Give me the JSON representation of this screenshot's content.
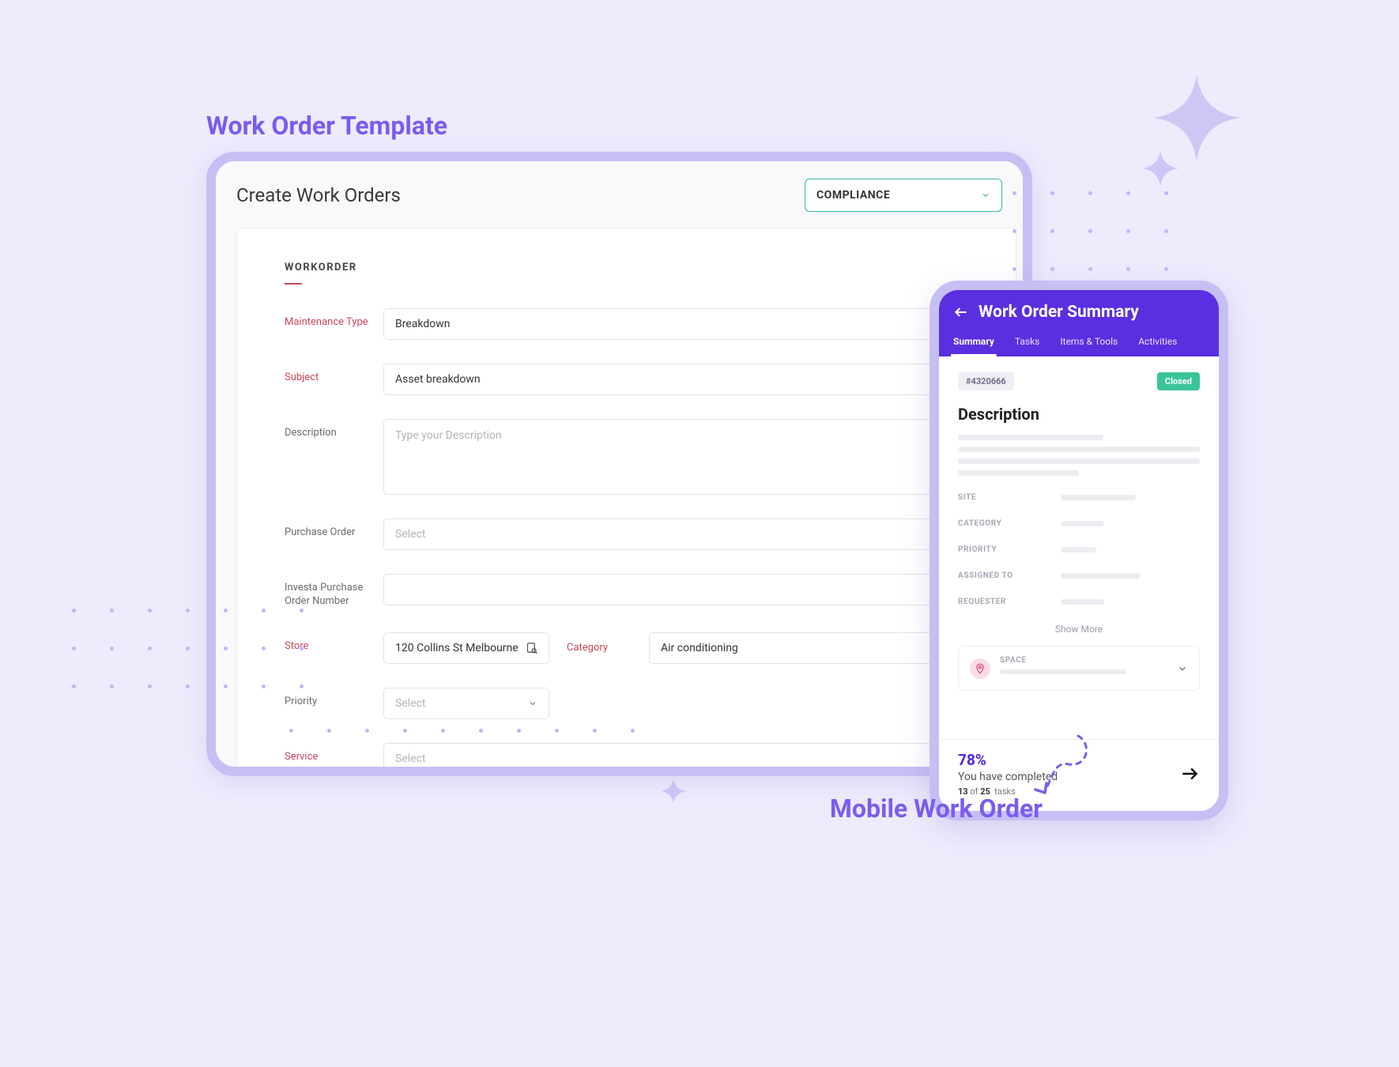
{
  "titles": {
    "template": "Work Order Template",
    "mobile": "Mobile Work Order"
  },
  "desktop": {
    "header": {
      "title": "Create Work Orders",
      "type_select": "COMPLIANCE"
    },
    "tab": "WORKORDER",
    "fields": {
      "maintenance_type": {
        "label": "Maintenance Type",
        "value": "Breakdown"
      },
      "subject": {
        "label": "Subject",
        "value": "Asset breakdown"
      },
      "description": {
        "label": "Description",
        "placeholder": "Type your  Description"
      },
      "purchase_order": {
        "label": "Purchase Order",
        "placeholder": "Select"
      },
      "investa_po": {
        "label": "Investa Purchase Order Number"
      },
      "store": {
        "label": "Store",
        "value": "120 Collins St Melbourne"
      },
      "category": {
        "label": "Category",
        "value": "Air conditioning"
      },
      "priority": {
        "label": "Priority",
        "placeholder": "Select"
      },
      "service": {
        "label": "Service",
        "placeholder": "Select"
      }
    }
  },
  "mobile": {
    "title": "Work Order Summary",
    "tabs": [
      "Summary",
      "Tasks",
      "Items & Tools",
      "Activities"
    ],
    "active_tab": 0,
    "id": "#4320666",
    "status": "Closed",
    "description_heading": "Description",
    "rows": {
      "site": "SITE",
      "category": "CATEGORY",
      "priority": "PRIORITY",
      "assigned_to": "ASSIGNED TO",
      "requester": "REQUESTER"
    },
    "show_more": "Show More",
    "space_label": "SPACE",
    "footer": {
      "percent": "78%",
      "line1": "You have completed",
      "done": "13",
      "of_word": "of",
      "total": "25",
      "tasks_word": "tasks"
    }
  }
}
